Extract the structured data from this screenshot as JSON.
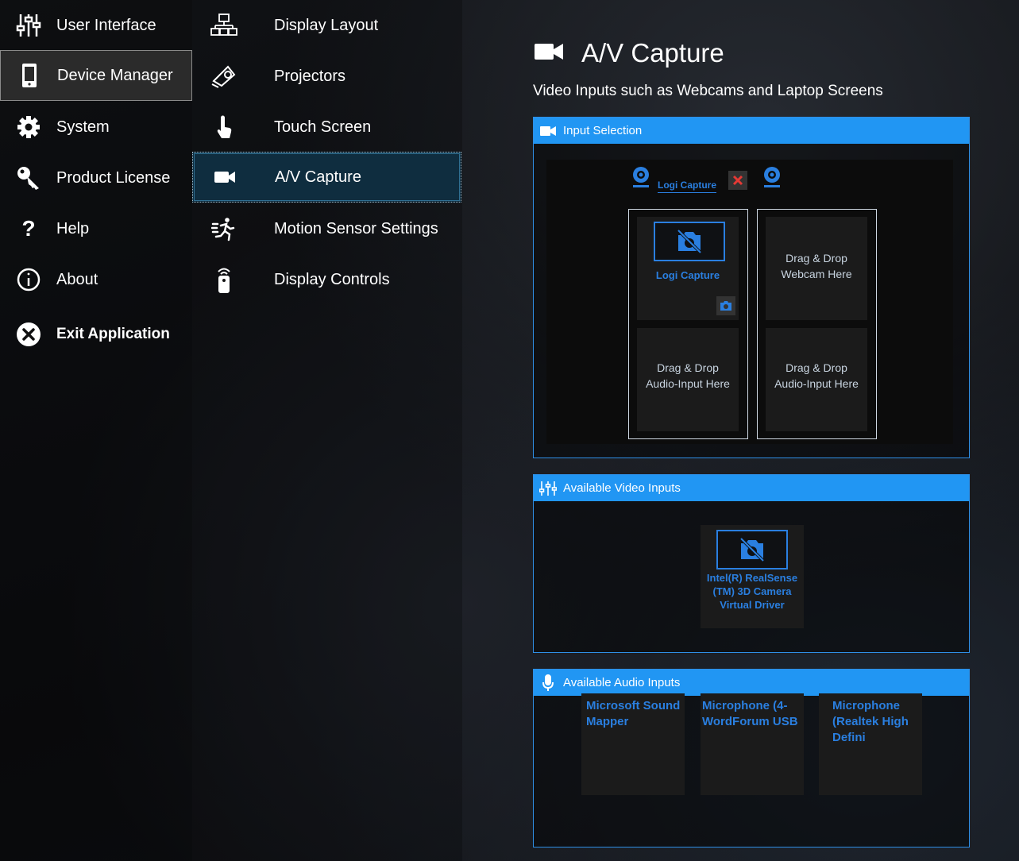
{
  "nav": {
    "items": [
      {
        "label": "User Interface",
        "icon": "sliders-icon"
      },
      {
        "label": "Device Manager",
        "icon": "phone-icon",
        "active": true
      },
      {
        "label": "System",
        "icon": "gear-icon"
      },
      {
        "label": "Product License",
        "icon": "key-icon"
      },
      {
        "label": "Help",
        "icon": "question-icon"
      },
      {
        "label": "About",
        "icon": "info-icon"
      }
    ],
    "exit_label": "Exit Application"
  },
  "subnav": {
    "items": [
      {
        "label": "Display Layout",
        "icon": "display-layout-icon"
      },
      {
        "label": "Projectors",
        "icon": "projector-icon"
      },
      {
        "label": "Touch Screen",
        "icon": "touch-icon"
      },
      {
        "label": "A/V Capture",
        "icon": "video-camera-icon",
        "active": true
      },
      {
        "label": "Motion Sensor Settings",
        "icon": "running-person-icon"
      },
      {
        "label": "Display Controls",
        "icon": "remote-control-icon"
      }
    ]
  },
  "page": {
    "title": "A/V Capture",
    "subtitle": "Video Inputs such as Webcams and Laptop Screens"
  },
  "input_selection": {
    "title": "Input Selection",
    "tab_label": "Logi Capture",
    "selected_webcam": "Logi Capture",
    "webcam_drop": "Drag & Drop\nWebcam Here",
    "audio_drop": "Drag & Drop\nAudio-Input Here"
  },
  "video_inputs": {
    "title": "Available Video Inputs",
    "devices": [
      {
        "name": "Intel(R) RealSense (TM) 3D Camera Virtual Driver"
      }
    ]
  },
  "audio_inputs": {
    "title": "Available Audio Inputs",
    "devices": [
      {
        "name": "Microsoft Sound Mapper"
      },
      {
        "name": "Microphone (4-WordForum USB"
      },
      {
        "name": "Microphone (Realtek High Defini"
      }
    ]
  },
  "colors": {
    "accent": "#2196f3",
    "link_blue": "#2a7fe0",
    "remove_red": "#e53935"
  }
}
